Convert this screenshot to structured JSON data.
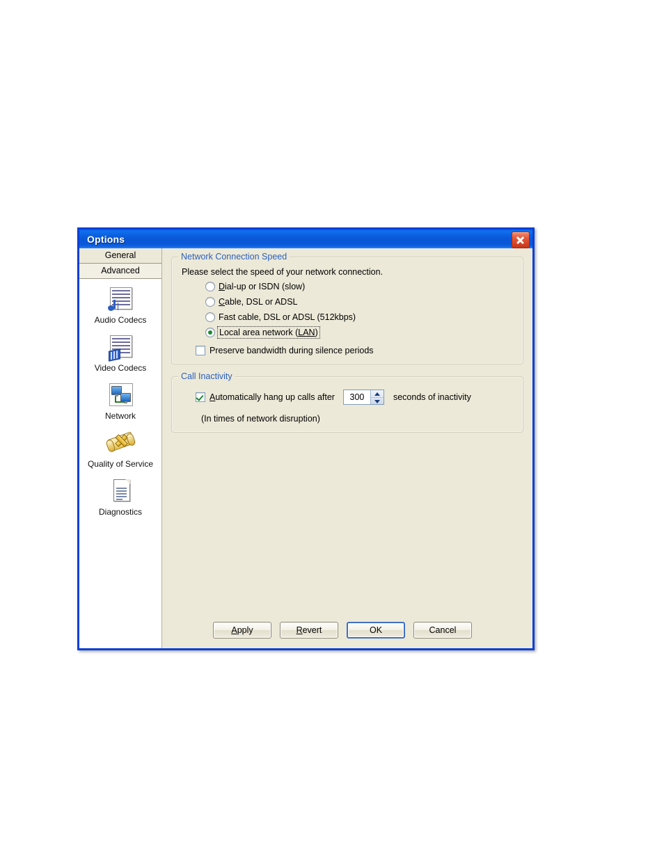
{
  "window": {
    "title": "Options",
    "close_icon": "close-icon"
  },
  "sidebar": {
    "tabs": [
      {
        "label": "General",
        "active": false
      },
      {
        "label": "Advanced",
        "active": true
      }
    ],
    "items": [
      {
        "label": "Audio Codecs",
        "icon": "audio-codecs-icon"
      },
      {
        "label": "Video Codecs",
        "icon": "video-codecs-icon"
      },
      {
        "label": "Network",
        "icon": "network-icon"
      },
      {
        "label": "Quality of Service",
        "icon": "quality-of-service-icon"
      },
      {
        "label": "Diagnostics",
        "icon": "diagnostics-icon"
      }
    ]
  },
  "network_speed_group": {
    "title": "Network Connection Speed",
    "instruction": "Please select the speed of your network connection.",
    "options": [
      {
        "label": "Dial-up or ISDN (slow)",
        "selected": false,
        "accel": "D"
      },
      {
        "label": "Cable, DSL or ADSL",
        "selected": false,
        "accel": "C"
      },
      {
        "label": "Fast cable, DSL or ADSL (512kbps)",
        "selected": false,
        "accel": ""
      },
      {
        "label": "Local area network (LAN)",
        "selected": true,
        "accel": "LAN",
        "focused": true
      }
    ],
    "preserve_bandwidth": {
      "label": "Preserve bandwidth during silence periods",
      "checked": false
    }
  },
  "call_inactivity_group": {
    "title": "Call Inactivity",
    "hangup": {
      "label": "Automatically hang up calls after",
      "checked": true,
      "accel": "A"
    },
    "timeout_value": "300",
    "timeout_suffix": "seconds of inactivity",
    "note": "(In times of network disruption)"
  },
  "footer": {
    "buttons": [
      {
        "label": "Apply",
        "default": false
      },
      {
        "label": "Revert",
        "default": false
      },
      {
        "label": "OK",
        "default": true
      },
      {
        "label": "Cancel",
        "default": false
      }
    ]
  },
  "colors": {
    "titlebar_blue": "#0a58d8",
    "dialog_face": "#ece9d8",
    "group_label_blue": "#2b5fbb",
    "radio_dot_green": "#1b8a2e",
    "check_green": "#1b8a2e",
    "close_red": "#c8341a"
  }
}
